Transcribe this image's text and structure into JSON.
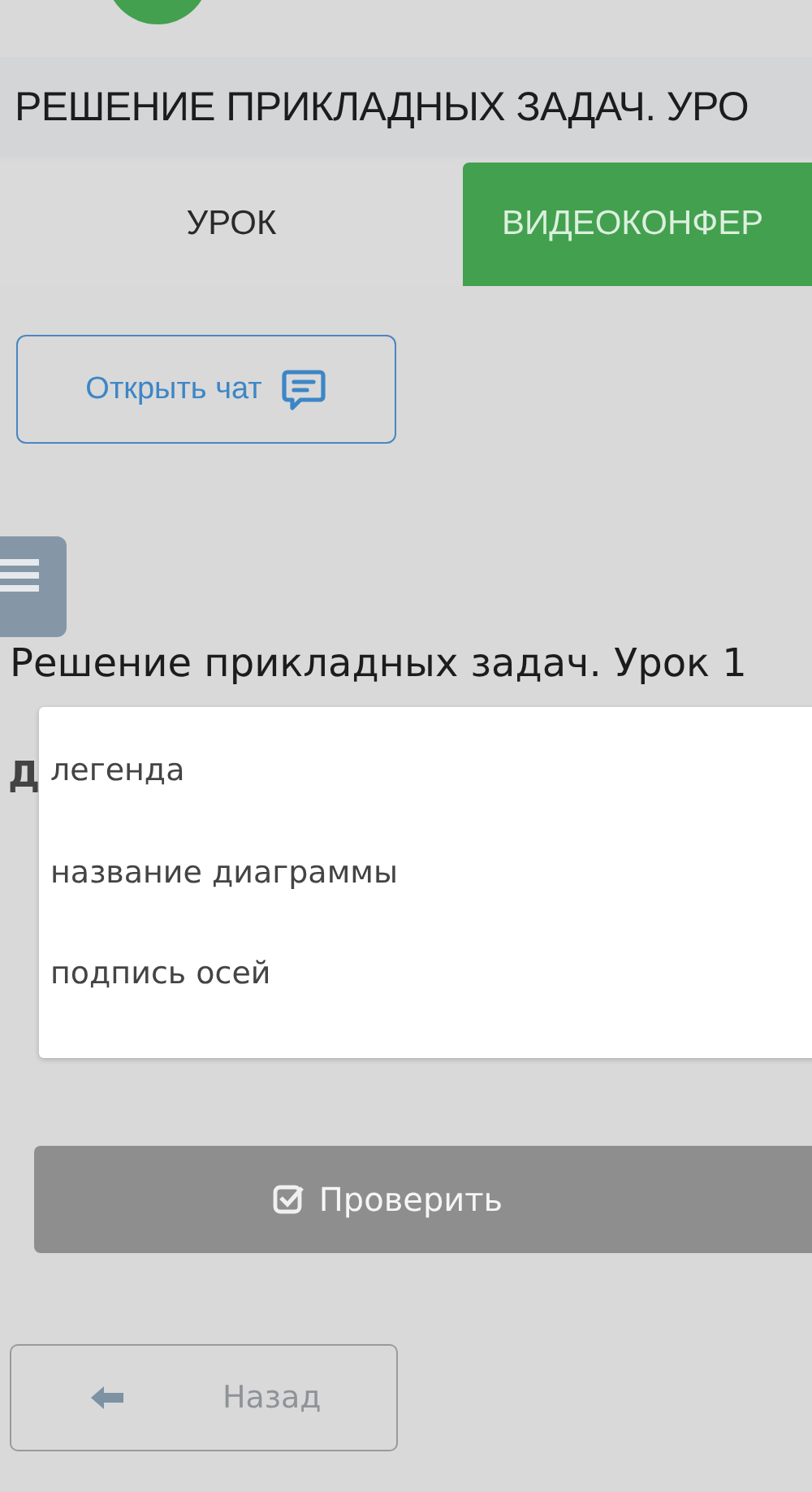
{
  "header": {
    "title": "РЕШЕНИЕ ПРИКЛАДНЫХ ЗАДАЧ. УРО"
  },
  "tabs": [
    {
      "label": "УРОК",
      "selected": true
    },
    {
      "label": "ВИДЕОКОНФЕР",
      "selected": false
    }
  ],
  "chat_button": {
    "label": "Открыть чат"
  },
  "lesson_title": "Решение прикладных задач. Урок 1",
  "question_fragment": "Д",
  "dropdown": {
    "options": [
      {
        "label": "легенда"
      },
      {
        "label": "название диаграммы"
      },
      {
        "label": "подпись осей"
      }
    ]
  },
  "check_button": {
    "label": "Проверить",
    "disabled": true
  },
  "back_button": {
    "label": "Назад"
  }
}
